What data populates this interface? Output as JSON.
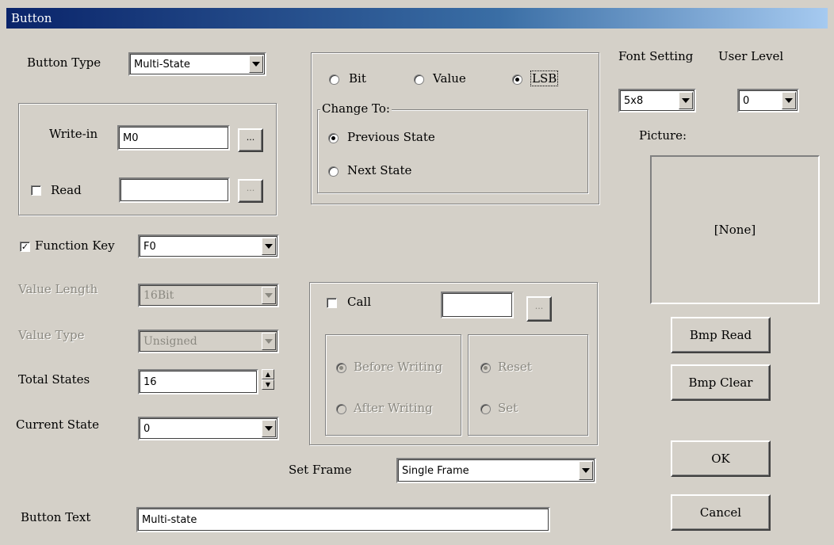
{
  "window": {
    "title": "Button"
  },
  "left": {
    "button_type_label": "Button Type",
    "button_type_value": "Multi-State",
    "write_in_label": "Write-in",
    "write_in_value": "M0",
    "read_label": "Read",
    "read_value": "",
    "read_checked": false,
    "browse_label": "...",
    "function_key_label": "Function Key",
    "function_key_checked": true,
    "function_key_value": "F0",
    "value_length_label": "Value Length",
    "value_length_value": "16Bit",
    "value_type_label": "Value Type",
    "value_type_value": "Unsigned",
    "total_states_label": "Total States",
    "total_states_value": "16",
    "current_state_label": "Current State",
    "current_state_value": "0",
    "button_text_label": "Button Text",
    "button_text_value": "Multi-state"
  },
  "mode": {
    "bit_label": "Bit",
    "value_label": "Value",
    "lsb_label": "LSB",
    "selected": "LSB",
    "change_to_label": "Change To:",
    "previous_state_label": "Previous State",
    "next_state_label": "Next State",
    "change_to_selected": "Previous State"
  },
  "call": {
    "call_label": "Call",
    "call_checked": false,
    "call_value": "",
    "browse_label": "...",
    "before_writing_label": "Before Writing",
    "after_writing_label": "After Writing",
    "reset_label": "Reset",
    "set_label": "Set"
  },
  "set_frame": {
    "label": "Set Frame",
    "value": "Single Frame"
  },
  "right": {
    "font_setting_label": "Font Setting",
    "font_setting_value": "5x8",
    "user_level_label": "User Level",
    "user_level_value": "0",
    "picture_label": "Picture:",
    "picture_value": "[None]",
    "bmp_read_label": "Bmp Read",
    "bmp_clear_label": "Bmp Clear",
    "ok_label": "OK",
    "cancel_label": "Cancel"
  }
}
